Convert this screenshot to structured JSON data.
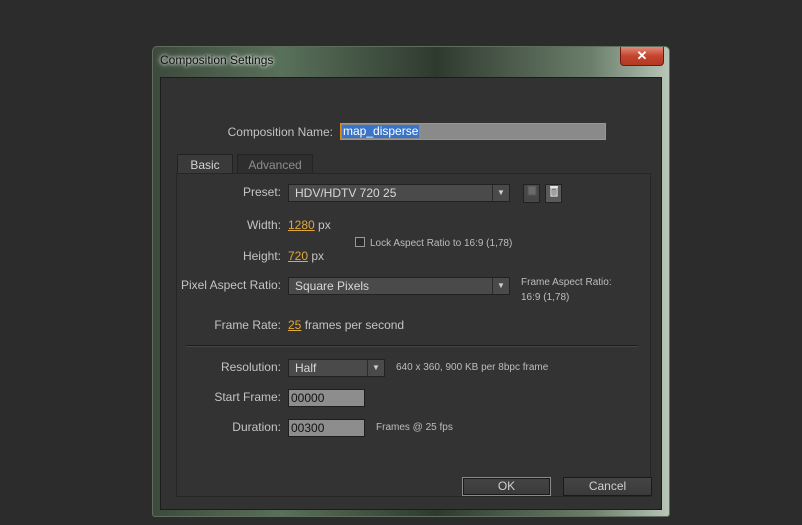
{
  "window": {
    "title": "Composition Settings",
    "close_label": "✕"
  },
  "name": {
    "label": "Composition Name:",
    "value": "map_disperse"
  },
  "tabs": [
    {
      "label": "Basic"
    },
    {
      "label": "Advanced"
    }
  ],
  "preset": {
    "label": "Preset:",
    "value": "HDV/HDTV 720 25"
  },
  "width": {
    "label": "Width:",
    "value": "1280",
    "unit": "px"
  },
  "height": {
    "label": "Height:",
    "value": "720",
    "unit": "px"
  },
  "lock_aspect": {
    "label": "Lock Aspect Ratio to 16:9 (1,78)",
    "checked": false
  },
  "pixel_aspect": {
    "label": "Pixel Aspect Ratio:",
    "value": "Square Pixels"
  },
  "frame_aspect": {
    "title": "Frame Aspect Ratio:",
    "value": "16:9 (1,78)"
  },
  "frame_rate": {
    "label": "Frame Rate:",
    "value": "25",
    "unit": "frames per second"
  },
  "resolution": {
    "label": "Resolution:",
    "value": "Half",
    "info": "640 x 360, 900 KB per 8bpc frame"
  },
  "start_frame": {
    "label": "Start Frame:",
    "value": "00000"
  },
  "duration": {
    "label": "Duration:",
    "value": "00300",
    "info": "Frames @ 25 fps"
  },
  "buttons": {
    "ok": "OK",
    "cancel": "Cancel"
  },
  "icons": {
    "save_preset": "save-preset-icon",
    "delete_preset": "trash-icon",
    "dropdown": "chevron-down-icon"
  }
}
